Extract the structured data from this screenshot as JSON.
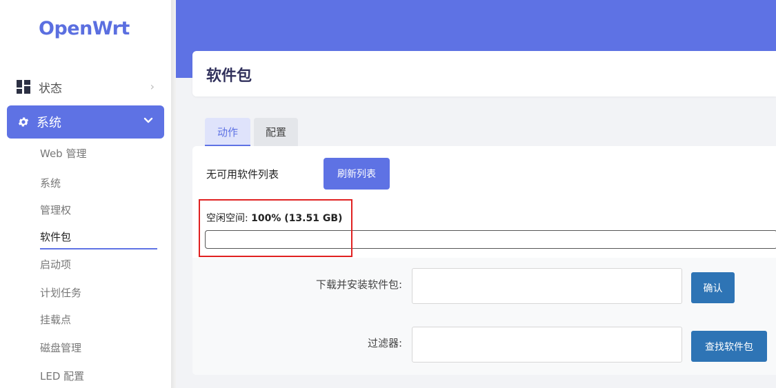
{
  "brand": "OpenWrt",
  "sidebar": {
    "status_label": "状态",
    "system_label": "系统",
    "sub_items": [
      "Web 管理",
      "系统",
      "管理权",
      "软件包",
      "启动项",
      "计划任务",
      "挂载点",
      "磁盘管理",
      "LED 配置"
    ],
    "active_item": "软件包"
  },
  "page": {
    "title": "软件包"
  },
  "tabs": [
    {
      "label": "动作",
      "active": true
    },
    {
      "label": "配置",
      "active": false
    }
  ],
  "actions": {
    "no_list_text": "无可用软件列表",
    "refresh_label": "刷新列表",
    "free_space_label": "空闲空间: ",
    "free_space_value": "100% (13.51 GB)",
    "free_space_percent": 100,
    "install_label": "下载并安装软件包:",
    "install_value": "",
    "confirm_label": "确认",
    "filter_label": "过滤器:",
    "filter_value": "",
    "find_label": "查找软件包"
  },
  "colors": {
    "accent": "#5e72e4",
    "button_blue": "#2e74b5",
    "highlight": "#e02020"
  }
}
